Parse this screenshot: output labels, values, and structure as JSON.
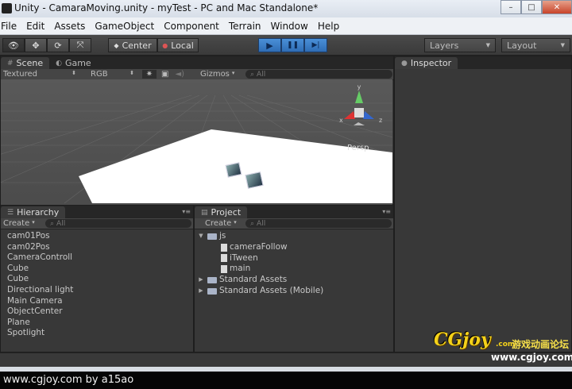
{
  "window": {
    "title": "Unity - CamaraMoving.unity - myTest - PC and Mac Standalone*",
    "controls": {
      "minimize": "–",
      "maximize": "□",
      "close": "✕"
    }
  },
  "menu": [
    "File",
    "Edit",
    "Assets",
    "GameObject",
    "Component",
    "Terrain",
    "Window",
    "Help"
  ],
  "toolbar": {
    "tools": [
      "hand-icon",
      "move-icon",
      "rotate-icon",
      "scale-icon"
    ],
    "pivot_label": "Center",
    "space_label": "Local",
    "play_icon": "▶",
    "pause_icon": "❚❚",
    "step_icon": "▶|",
    "layers_label": "Layers",
    "layout_label": "Layout"
  },
  "scene": {
    "tabs": {
      "scene": "Scene",
      "game": "Game"
    },
    "render_mode": "Textured",
    "color_mode": "RGB",
    "gizmos_label": "Gizmos",
    "search_placeholder": "All",
    "persp_label": "Persp",
    "axes": {
      "x": "x",
      "y": "y",
      "z": "z"
    }
  },
  "inspector": {
    "tab": "Inspector"
  },
  "hierarchy": {
    "tab": "Hierarchy",
    "create_label": "Create",
    "search_placeholder": "All",
    "items": [
      "cam01Pos",
      "cam02Pos",
      "CameraControll",
      "Cube",
      "Cube",
      "Directional light",
      "Main Camera",
      "ObjectCenter",
      "Plane",
      "Spotlight"
    ]
  },
  "project": {
    "tab": "Project",
    "create_label": "Create",
    "search_placeholder": "All",
    "tree": [
      {
        "name": "js",
        "type": "folder",
        "expanded": true,
        "level": 0
      },
      {
        "name": "cameraFollow",
        "type": "script",
        "level": 1
      },
      {
        "name": "iTween",
        "type": "script",
        "level": 1
      },
      {
        "name": "main",
        "type": "script",
        "level": 1
      },
      {
        "name": "Standard Assets",
        "type": "folder",
        "expanded": false,
        "level": 0
      },
      {
        "name": "Standard Assets (Mobile)",
        "type": "folder",
        "expanded": false,
        "level": 0
      }
    ]
  },
  "watermark": {
    "logo": "CGjoy",
    "logo_suffix": ".com",
    "chinese": "游戏动画论坛",
    "url": "www.cgjoy.com"
  },
  "caption": "www.cgjoy.com by a15ao",
  "colors": {
    "editor_bg": "#383838",
    "play_blue": "#2f6db5",
    "watermark_yellow": "#f4d21a"
  }
}
